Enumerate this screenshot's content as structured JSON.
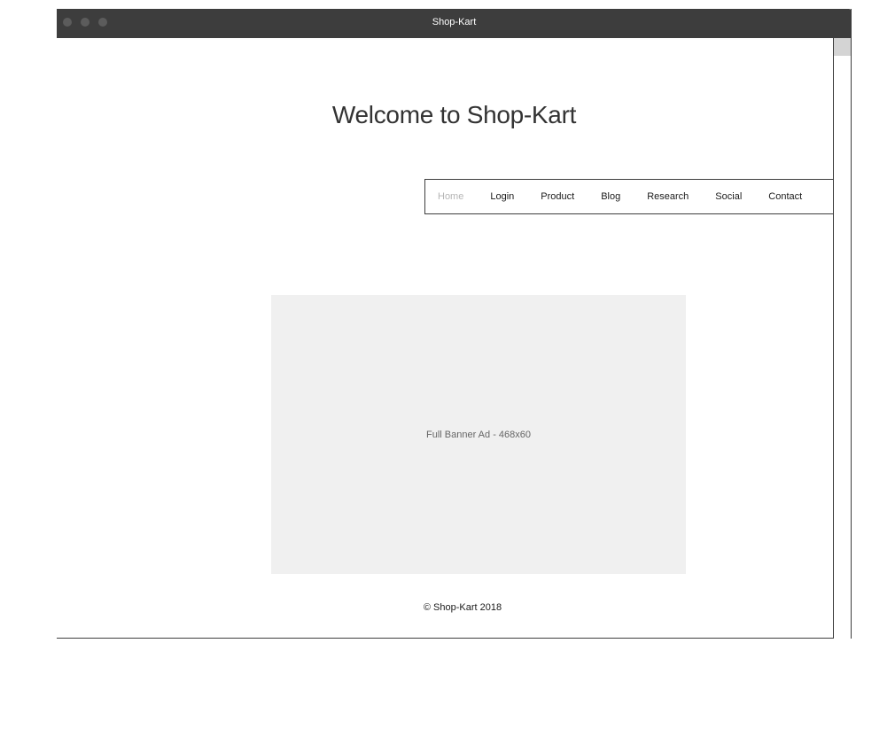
{
  "window": {
    "title": "Shop-Kart"
  },
  "page": {
    "heading": "Welcome to Shop-Kart"
  },
  "nav": {
    "items": [
      {
        "label": "Home",
        "active": true
      },
      {
        "label": "Login",
        "active": false
      },
      {
        "label": "Product",
        "active": false
      },
      {
        "label": "Blog",
        "active": false
      },
      {
        "label": "Research",
        "active": false
      },
      {
        "label": "Social",
        "active": false
      },
      {
        "label": "Contact",
        "active": false
      }
    ]
  },
  "banner": {
    "label": "Full Banner Ad - 468x60"
  },
  "footer": {
    "text": "© Shop-Kart 2018"
  },
  "colors": {
    "titlebar": "#3d3d3d",
    "banner_bg": "#f0f0f0",
    "nav_active": "#b5b5b5"
  }
}
